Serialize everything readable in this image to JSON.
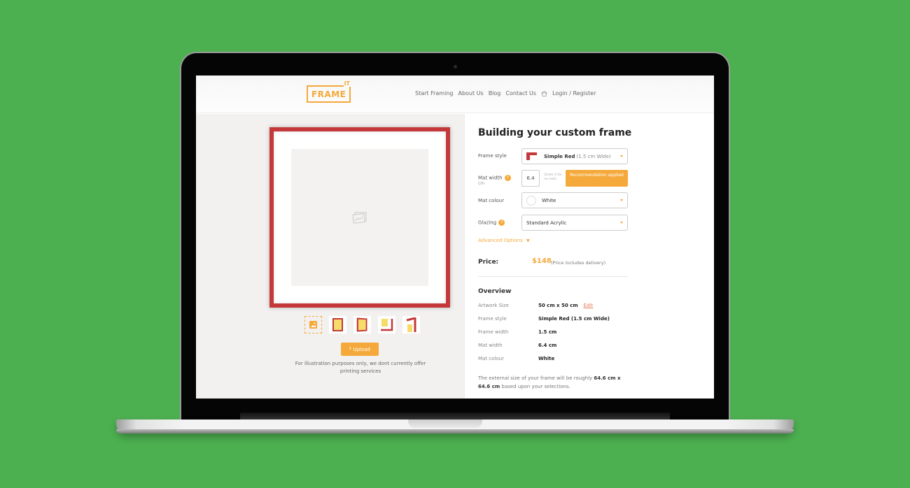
{
  "header": {
    "logo_text": "FRAME",
    "logo_superscript": "IT",
    "nav": [
      "Start Framing",
      "About Us",
      "Blog",
      "Contact Us"
    ],
    "cart_icon": "cart-icon",
    "login": "Login / Register"
  },
  "preview": {
    "placeholder_icon": "image-placeholder-icon",
    "frame_color": "#c4383a",
    "thumbnails": [
      {
        "name": "upload-image-thumbnail",
        "selected": true
      },
      {
        "name": "front-view-thumbnail",
        "selected": false
      },
      {
        "name": "angled-view-thumbnail",
        "selected": false
      },
      {
        "name": "corner-detail-thumbnail",
        "selected": false
      },
      {
        "name": "side-profile-thumbnail",
        "selected": false
      }
    ],
    "upload_label": "Upload",
    "disclaimer": "For illustration purposes only, we dont currently offer printing services"
  },
  "builder": {
    "title": "Building your custom frame",
    "frame_style": {
      "label": "Frame style",
      "value": "Simple Red",
      "detail": "(1.5 cm Wide)"
    },
    "mat_width": {
      "label": "Mat width",
      "unit": "cm",
      "value": "6.4",
      "hint": "(Enter 0 for no mat)",
      "recommendation": "Recommendation applied"
    },
    "mat_colour": {
      "label": "Mat colour",
      "value": "White"
    },
    "glazing": {
      "label": "Glazing",
      "value": "Standard Acrylic"
    },
    "advanced": "Advanced Options",
    "price_label": "Price:",
    "price": "$148",
    "price_note": "(Price includes delivery)"
  },
  "overview": {
    "title": "Overview",
    "rows": [
      {
        "key": "Artwork Size",
        "value": "50 cm x 50 cm"
      },
      {
        "key": "Frame style",
        "value": "Simple Red (1.5 cm Wide)"
      },
      {
        "key": "Frame width",
        "value": "1.5 cm"
      },
      {
        "key": "Mat width",
        "value": "6.4 cm"
      },
      {
        "key": "Mat colour",
        "value": "White"
      }
    ],
    "edit_label": "Edit",
    "footnote_pre": "The external size of your frame will be roughly ",
    "footnote_size": "64.6 cm x 64.6 cm",
    "footnote_post": " based upon your selections."
  },
  "colors": {
    "accent": "#f5a93a",
    "frame_red": "#c4383a",
    "background": "#4caf50"
  }
}
